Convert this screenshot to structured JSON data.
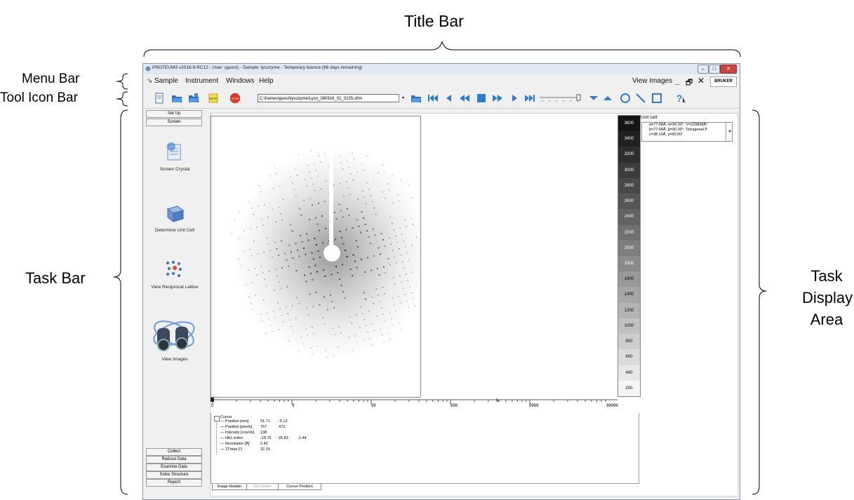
{
  "annotations": {
    "title_bar": "Title Bar",
    "menu_bar": "Menu Bar",
    "tool_icon_bar": "Tool Icon Bar",
    "task_bar": "Task Bar",
    "task_display_area": [
      "Task",
      "Display",
      "Area"
    ]
  },
  "window": {
    "title": "PROTEUM3 v2016.9-RC12 - User: (guest) - Sample: lysozyme - Temporary licence (66 days remaining)",
    "menu": [
      "Sample",
      "Instrument",
      "Windows",
      "Help"
    ],
    "view_images_label": "View Images",
    "brand": "BRUKER"
  },
  "toolbar": {
    "path": "C:\\frames\\guest\\lysozyme\\Lyso_080916_01_0155.sfrm"
  },
  "taskbar": {
    "top_buttons": [
      "Set Up",
      "Screen"
    ],
    "tasks": [
      "Screen Crystal",
      "Determine Unit Cell",
      "View Reciprocal Lattice",
      "View Images"
    ],
    "bottom_buttons": [
      "Collect",
      "Reduce Data",
      "Examine Data",
      "Solve Structure",
      "Report"
    ]
  },
  "colorbar": {
    "ticks": [
      "3600",
      "3400",
      "3200",
      "3000",
      "2800",
      "2600",
      "2400",
      "2200",
      "2000",
      "1800",
      "1600",
      "1400",
      "1200",
      "1000",
      "800",
      "600",
      "400",
      "200"
    ]
  },
  "unit_cell": {
    "label": "Unit cell:",
    "lines": [
      "a=77.68Å,  α=90.00°,  V=229898Å³",
      "b=77.68Å,  β=90.00°,  Tetragonal P",
      "c=38.10Å,  γ=90.00°"
    ]
  },
  "slider_scale": [
    "0",
    "9",
    "99",
    "999",
    "9999",
    "99999"
  ],
  "cursor_panel": {
    "title": "Cursor",
    "rows": [
      {
        "label": "Position [mm]",
        "v1": "51.71",
        "v2": "-5.13",
        "v3": ""
      },
      {
        "label": "Position [pixels]",
        "v1": "767",
        "v2": "473",
        "v3": ""
      },
      {
        "label": "Intensity [counts]",
        "v1": "138",
        "v2": "",
        "v3": ""
      },
      {
        "label": "HKL index",
        "v1": "-18.75",
        "v2": "25.83",
        "v3": "-1.44"
      },
      {
        "label": "Resolution [Å]",
        "v1": "2.42",
        "v2": "",
        "v3": ""
      },
      {
        "label": "2Theta [°]",
        "v1": "32.15",
        "v2": "",
        "v3": ""
      }
    ]
  },
  "bottom_tabs": [
    "Image Header",
    "Tool Editor",
    "Cursor Position"
  ]
}
